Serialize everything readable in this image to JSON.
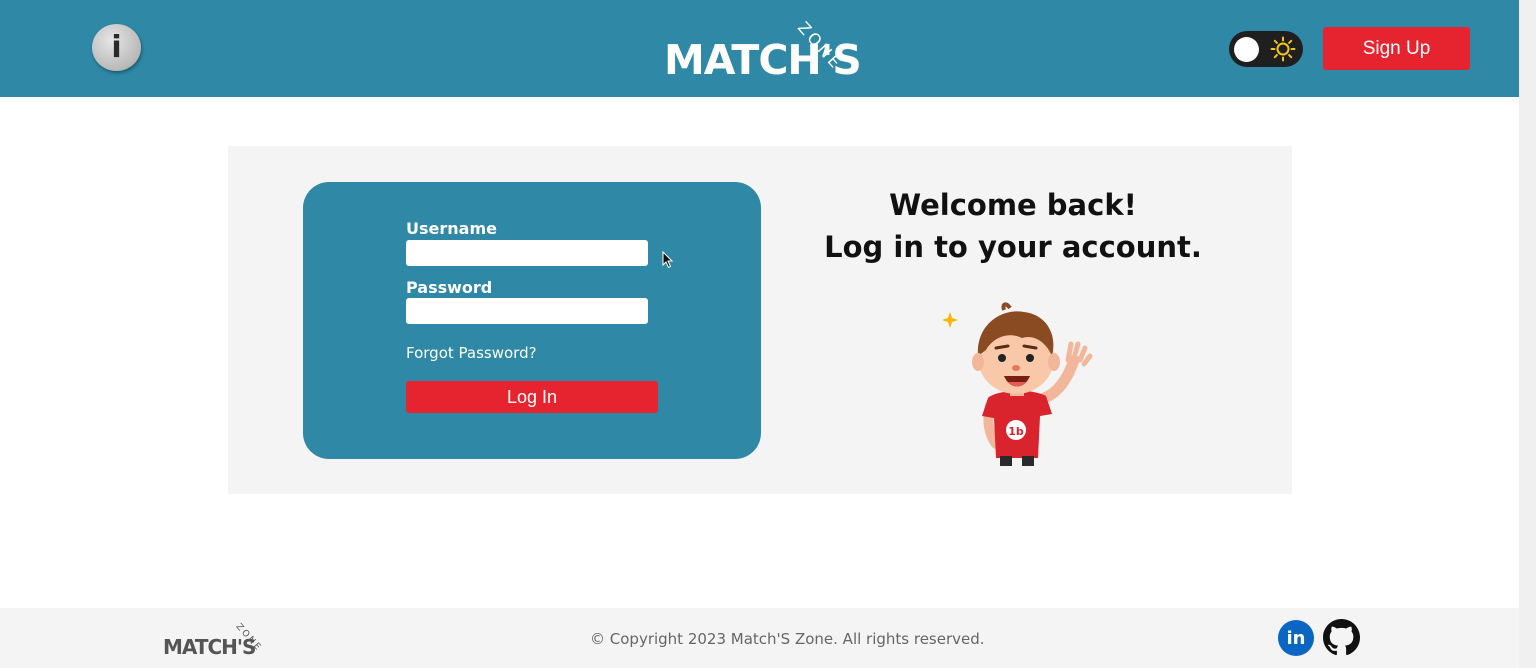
{
  "header": {
    "info_icon_glyph": "i",
    "logo": {
      "main": "MATCH'S",
      "zone": "ZONE"
    },
    "signup_label": "Sign Up",
    "theme_toggle": "light-mode"
  },
  "login": {
    "username_label": "Username",
    "username_value": "",
    "password_label": "Password",
    "password_value": "",
    "forgot_label": "Forgot Password?",
    "login_label": "Log In"
  },
  "welcome": {
    "line1": "Welcome back!",
    "line2": "Log in to your account."
  },
  "footer": {
    "logo": {
      "main": "MATCH'S",
      "zone": "ZONE"
    },
    "copyright": "© Copyright 2023 Match'S Zone. All rights reserved.",
    "linkedin_glyph": "in"
  },
  "colors": {
    "header_bg": "#2e88a6",
    "accent_red": "#e5242f",
    "card_bg": "#2e88a6"
  },
  "icons": [
    "info-icon",
    "sun-icon",
    "linkedin-icon",
    "github-icon",
    "character-illustration",
    "mouse-cursor"
  ]
}
